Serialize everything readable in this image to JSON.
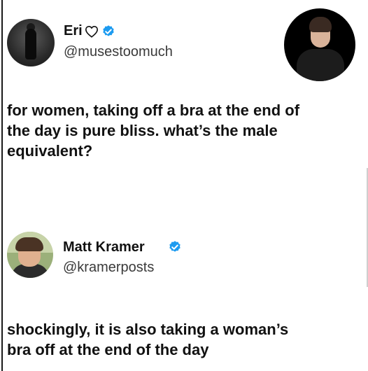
{
  "colors": {
    "verified_badge": "#1d9bf0",
    "text_primary": "#111111",
    "text_secondary": "#3a3a3a",
    "background": "#ffffff"
  },
  "tweet1": {
    "author": {
      "name": "Eri",
      "handle": "@musestoomuch",
      "name_icon": "heart-outline-icon",
      "verified_icon": "verified-badge-icon"
    },
    "text_lines": [
      "for women, taking off a bra at the end of",
      "the day is pure bliss. what’s the male",
      "equivalent?"
    ]
  },
  "tweet2": {
    "author": {
      "name": "Matt Kramer",
      "handle": "@kramerposts",
      "verified_icon": "verified-badge-icon"
    },
    "text_lines": [
      "shockingly, it is also taking a woman’s",
      "bra off at the end of the day"
    ]
  }
}
